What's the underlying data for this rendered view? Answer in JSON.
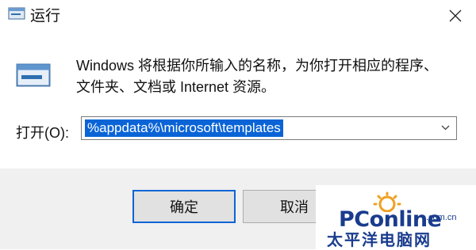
{
  "window": {
    "title": "运行",
    "icon": "run-icon"
  },
  "description": "Windows 将根据你所输入的名称，为你打开相应的程序、文件夹、文档或 Internet 资源。",
  "open_field": {
    "label": "打开(O):",
    "value": "%appdata%\\microsoft\\templates"
  },
  "buttons": {
    "ok": "确定",
    "cancel": "取消"
  },
  "watermark": {
    "logo": "PConline",
    "domain": ".com.cn",
    "sub": "太平洋电脑网"
  },
  "colors": {
    "selection": "#0a64d6",
    "footer_bg": "#f0f0f0",
    "watermark_text": "#1a3c8e"
  }
}
